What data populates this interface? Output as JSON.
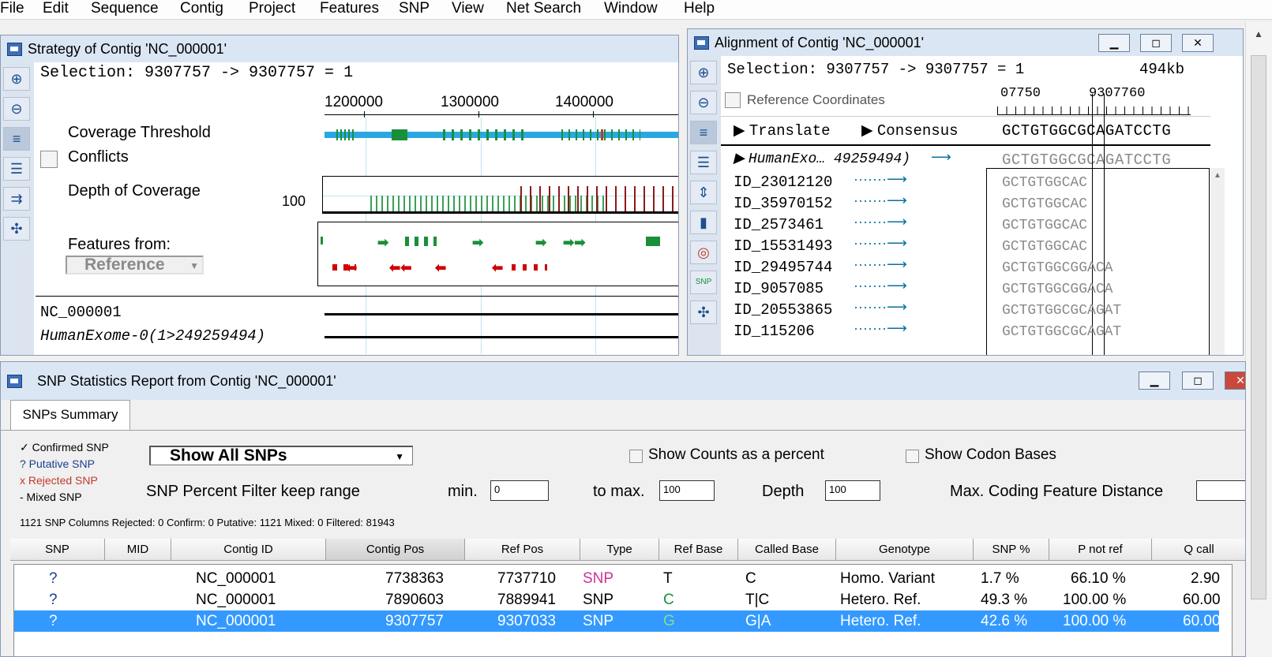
{
  "menu": [
    "File",
    "Edit",
    "Sequence",
    "Contig",
    "Project",
    "Features",
    "SNP",
    "View",
    "Net Search",
    "Window",
    "Help"
  ],
  "strategy": {
    "title": "Strategy of Contig 'NC_000001'",
    "selection": "Selection: 9307757 -> 9307757 = 1",
    "ruler": [
      "1200000",
      "1300000",
      "1400000"
    ],
    "coverage_threshold": "Coverage Threshold",
    "conflicts": "Conflicts",
    "depth_of_coverage": "Depth of Coverage",
    "depth_tick": "100",
    "features_from": "Features from:",
    "features_source": "Reference",
    "tracks": [
      "NC_000001",
      "HumanExome-0(1>249259494)"
    ]
  },
  "alignment": {
    "title": "Alignment of Contig 'NC_000001'",
    "selection": "Selection: 9307757 -> 9307757 = 1",
    "size": "494kb",
    "reference_coordinates": "Reference Coordinates",
    "ruler": [
      "07750",
      "9307760"
    ],
    "translate": "Translate",
    "consensus": "Consensus",
    "consensus_seq": "GCTGTGGCGCAGATCCTG",
    "reference_row": {
      "label": "HumanExo… 49259494)",
      "seq": "GCTGTGGCGCAGATCCTG"
    },
    "reads": [
      {
        "id": "ID_23012120",
        "seq": "GCTGTGGCAC"
      },
      {
        "id": "ID_35970152",
        "seq": "GCTGTGGCAC"
      },
      {
        "id": "ID_2573461",
        "seq": "GCTGTGGCAC"
      },
      {
        "id": "ID_15531493",
        "seq": "GCTGTGGCAC"
      },
      {
        "id": "ID_29495744",
        "seq": "GCTGTGGCGGACA"
      },
      {
        "id": "ID_9057085",
        "seq": "GCTGTGGCGGACA"
      },
      {
        "id": "ID_20553865",
        "seq": "GCTGTGGCGCAGAT"
      },
      {
        "id": "ID_115206",
        "seq": "GCTGTGGCGCAGAT"
      }
    ]
  },
  "snp_report": {
    "title": "SNP Statistics Report from Contig 'NC_000001'",
    "tab": "SNPs Summary",
    "legend": [
      "✓ Confirmed SNP",
      "? Putative SNP",
      "x Rejected SNP",
      "- Mixed SNP"
    ],
    "filter_select": "Show All SNPs",
    "show_counts_percent": "Show Counts as a percent",
    "show_codon_bases": "Show Codon Bases",
    "percent_filter": "SNP Percent Filter  keep range",
    "min_label": "min.",
    "min_value": "0",
    "to_max_label": "to max.",
    "max_value": "100",
    "depth_label": "Depth",
    "depth_value": "100",
    "max_coding_label": "Max. Coding Feature Distance",
    "status": "1121 SNP Columns Rejected: 0 Confirm: 0 Putative: 1121 Mixed: 0 Filtered: 81943",
    "columns": [
      "SNP",
      "MID",
      "Contig ID",
      "Contig Pos",
      "Ref Pos",
      "Type",
      "Ref Base",
      "Called Base",
      "Genotype",
      "SNP %",
      "P not ref",
      "Q call"
    ],
    "rows": [
      {
        "snp": "?",
        "mid": "",
        "contig": "NC_000001",
        "contig_pos": "7738363",
        "ref_pos": "7737710",
        "type": "SNP",
        "ref_base": "T",
        "called": "C",
        "genotype": "Homo. Variant",
        "pct": "1.7 %",
        "pnot": "66.10 %",
        "q": "2.90"
      },
      {
        "snp": "?",
        "mid": "",
        "contig": "NC_000001",
        "contig_pos": "7890603",
        "ref_pos": "7889941",
        "type": "SNP",
        "ref_base": "C",
        "called": "T|C",
        "genotype": "Hetero. Ref.",
        "pct": "49.3 %",
        "pnot": "100.00 %",
        "q": "60.00"
      },
      {
        "snp": "?",
        "mid": "",
        "contig": "NC_000001",
        "contig_pos": "9307757",
        "ref_pos": "9307033",
        "type": "SNP",
        "ref_base": "G",
        "called": "G|A",
        "genotype": "Hetero. Ref.",
        "pct": "42.6 %",
        "pnot": "100.00 %",
        "q": "60.00"
      }
    ]
  },
  "colors": {
    "selection": "#3399ff",
    "titlebar": "#dbe6f4",
    "snp_pink": "#cc3399",
    "base_green": "#1a8f3a",
    "coverage_blue": "#29a8e0"
  }
}
